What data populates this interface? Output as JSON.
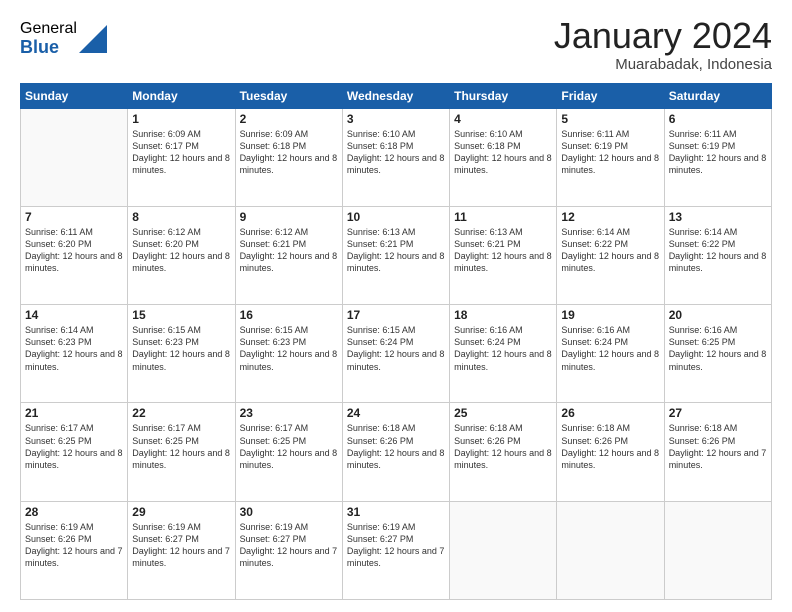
{
  "logo": {
    "general": "General",
    "blue": "Blue"
  },
  "header": {
    "month": "January 2024",
    "location": "Muarabadak, Indonesia"
  },
  "weekdays": [
    "Sunday",
    "Monday",
    "Tuesday",
    "Wednesday",
    "Thursday",
    "Friday",
    "Saturday"
  ],
  "weeks": [
    [
      {
        "day": "",
        "sunrise": "",
        "sunset": "",
        "daylight": ""
      },
      {
        "day": "1",
        "sunrise": "Sunrise: 6:09 AM",
        "sunset": "Sunset: 6:17 PM",
        "daylight": "Daylight: 12 hours and 8 minutes."
      },
      {
        "day": "2",
        "sunrise": "Sunrise: 6:09 AM",
        "sunset": "Sunset: 6:18 PM",
        "daylight": "Daylight: 12 hours and 8 minutes."
      },
      {
        "day": "3",
        "sunrise": "Sunrise: 6:10 AM",
        "sunset": "Sunset: 6:18 PM",
        "daylight": "Daylight: 12 hours and 8 minutes."
      },
      {
        "day": "4",
        "sunrise": "Sunrise: 6:10 AM",
        "sunset": "Sunset: 6:18 PM",
        "daylight": "Daylight: 12 hours and 8 minutes."
      },
      {
        "day": "5",
        "sunrise": "Sunrise: 6:11 AM",
        "sunset": "Sunset: 6:19 PM",
        "daylight": "Daylight: 12 hours and 8 minutes."
      },
      {
        "day": "6",
        "sunrise": "Sunrise: 6:11 AM",
        "sunset": "Sunset: 6:19 PM",
        "daylight": "Daylight: 12 hours and 8 minutes."
      }
    ],
    [
      {
        "day": "7",
        "sunrise": "Sunrise: 6:11 AM",
        "sunset": "Sunset: 6:20 PM",
        "daylight": "Daylight: 12 hours and 8 minutes."
      },
      {
        "day": "8",
        "sunrise": "Sunrise: 6:12 AM",
        "sunset": "Sunset: 6:20 PM",
        "daylight": "Daylight: 12 hours and 8 minutes."
      },
      {
        "day": "9",
        "sunrise": "Sunrise: 6:12 AM",
        "sunset": "Sunset: 6:21 PM",
        "daylight": "Daylight: 12 hours and 8 minutes."
      },
      {
        "day": "10",
        "sunrise": "Sunrise: 6:13 AM",
        "sunset": "Sunset: 6:21 PM",
        "daylight": "Daylight: 12 hours and 8 minutes."
      },
      {
        "day": "11",
        "sunrise": "Sunrise: 6:13 AM",
        "sunset": "Sunset: 6:21 PM",
        "daylight": "Daylight: 12 hours and 8 minutes."
      },
      {
        "day": "12",
        "sunrise": "Sunrise: 6:14 AM",
        "sunset": "Sunset: 6:22 PM",
        "daylight": "Daylight: 12 hours and 8 minutes."
      },
      {
        "day": "13",
        "sunrise": "Sunrise: 6:14 AM",
        "sunset": "Sunset: 6:22 PM",
        "daylight": "Daylight: 12 hours and 8 minutes."
      }
    ],
    [
      {
        "day": "14",
        "sunrise": "Sunrise: 6:14 AM",
        "sunset": "Sunset: 6:23 PM",
        "daylight": "Daylight: 12 hours and 8 minutes."
      },
      {
        "day": "15",
        "sunrise": "Sunrise: 6:15 AM",
        "sunset": "Sunset: 6:23 PM",
        "daylight": "Daylight: 12 hours and 8 minutes."
      },
      {
        "day": "16",
        "sunrise": "Sunrise: 6:15 AM",
        "sunset": "Sunset: 6:23 PM",
        "daylight": "Daylight: 12 hours and 8 minutes."
      },
      {
        "day": "17",
        "sunrise": "Sunrise: 6:15 AM",
        "sunset": "Sunset: 6:24 PM",
        "daylight": "Daylight: 12 hours and 8 minutes."
      },
      {
        "day": "18",
        "sunrise": "Sunrise: 6:16 AM",
        "sunset": "Sunset: 6:24 PM",
        "daylight": "Daylight: 12 hours and 8 minutes."
      },
      {
        "day": "19",
        "sunrise": "Sunrise: 6:16 AM",
        "sunset": "Sunset: 6:24 PM",
        "daylight": "Daylight: 12 hours and 8 minutes."
      },
      {
        "day": "20",
        "sunrise": "Sunrise: 6:16 AM",
        "sunset": "Sunset: 6:25 PM",
        "daylight": "Daylight: 12 hours and 8 minutes."
      }
    ],
    [
      {
        "day": "21",
        "sunrise": "Sunrise: 6:17 AM",
        "sunset": "Sunset: 6:25 PM",
        "daylight": "Daylight: 12 hours and 8 minutes."
      },
      {
        "day": "22",
        "sunrise": "Sunrise: 6:17 AM",
        "sunset": "Sunset: 6:25 PM",
        "daylight": "Daylight: 12 hours and 8 minutes."
      },
      {
        "day": "23",
        "sunrise": "Sunrise: 6:17 AM",
        "sunset": "Sunset: 6:25 PM",
        "daylight": "Daylight: 12 hours and 8 minutes."
      },
      {
        "day": "24",
        "sunrise": "Sunrise: 6:18 AM",
        "sunset": "Sunset: 6:26 PM",
        "daylight": "Daylight: 12 hours and 8 minutes."
      },
      {
        "day": "25",
        "sunrise": "Sunrise: 6:18 AM",
        "sunset": "Sunset: 6:26 PM",
        "daylight": "Daylight: 12 hours and 8 minutes."
      },
      {
        "day": "26",
        "sunrise": "Sunrise: 6:18 AM",
        "sunset": "Sunset: 6:26 PM",
        "daylight": "Daylight: 12 hours and 8 minutes."
      },
      {
        "day": "27",
        "sunrise": "Sunrise: 6:18 AM",
        "sunset": "Sunset: 6:26 PM",
        "daylight": "Daylight: 12 hours and 7 minutes."
      }
    ],
    [
      {
        "day": "28",
        "sunrise": "Sunrise: 6:19 AM",
        "sunset": "Sunset: 6:26 PM",
        "daylight": "Daylight: 12 hours and 7 minutes."
      },
      {
        "day": "29",
        "sunrise": "Sunrise: 6:19 AM",
        "sunset": "Sunset: 6:27 PM",
        "daylight": "Daylight: 12 hours and 7 minutes."
      },
      {
        "day": "30",
        "sunrise": "Sunrise: 6:19 AM",
        "sunset": "Sunset: 6:27 PM",
        "daylight": "Daylight: 12 hours and 7 minutes."
      },
      {
        "day": "31",
        "sunrise": "Sunrise: 6:19 AM",
        "sunset": "Sunset: 6:27 PM",
        "daylight": "Daylight: 12 hours and 7 minutes."
      },
      {
        "day": "",
        "sunrise": "",
        "sunset": "",
        "daylight": ""
      },
      {
        "day": "",
        "sunrise": "",
        "sunset": "",
        "daylight": ""
      },
      {
        "day": "",
        "sunrise": "",
        "sunset": "",
        "daylight": ""
      }
    ]
  ]
}
